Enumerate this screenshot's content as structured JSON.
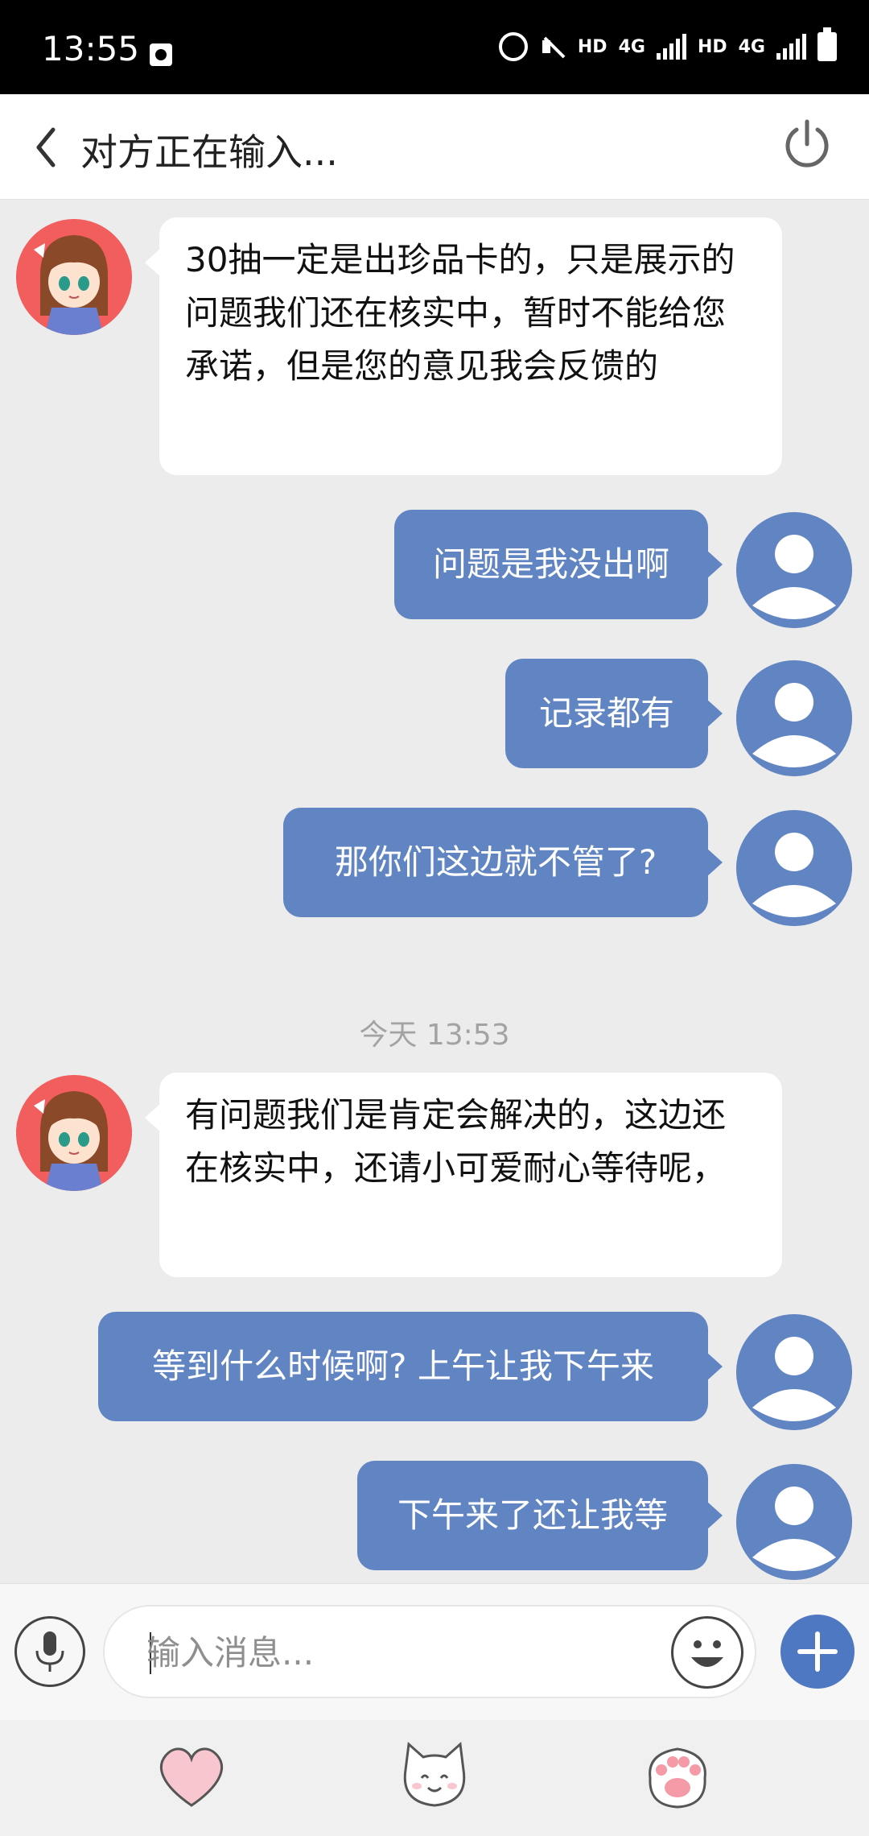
{
  "status_bar": {
    "time": "13:55",
    "hd1": "HD",
    "net1": "4G",
    "hd2": "HD",
    "net2": "4G"
  },
  "header": {
    "title": "对方正在输入...",
    "back_icon": "chevron-left-icon",
    "power_icon": "power-icon"
  },
  "messages": [
    {
      "side": "in",
      "text": "30抽一定是出珍品卡的，只是展示的问题我们还在核实中，暂时不能给您承诺，但是您的意见我会反馈的"
    },
    {
      "side": "out",
      "text": "问题是我没出啊"
    },
    {
      "side": "out",
      "text": "记录都有"
    },
    {
      "side": "out",
      "text": "那你们这边就不管了?"
    },
    {
      "side": "in",
      "text": "有问题我们是肯定会解决的，这边还在核实中，还请小可爱耐心等待呢，"
    },
    {
      "side": "out",
      "text": "等到什么时候啊? 上午让我下午来"
    },
    {
      "side": "out",
      "text": "下午来了还让我等"
    }
  ],
  "timestamp": "今天 13:53",
  "input": {
    "placeholder": "输入消息...",
    "value": ""
  },
  "bottom_bar": {
    "items": [
      "heart-icon",
      "cat-face-icon",
      "paw-icon"
    ]
  },
  "colors": {
    "user_bubble": "#6185c2",
    "agent_bubble": "#ffffff",
    "chat_bg": "#ececec",
    "accent": "#4f78c2"
  }
}
